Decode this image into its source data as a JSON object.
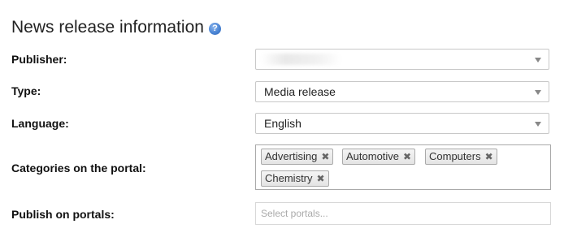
{
  "section": {
    "title": "News release information",
    "help_icon": "question-mark-icon"
  },
  "fields": {
    "publisher": {
      "label": "Publisher:",
      "value": ""
    },
    "type": {
      "label": "Type:",
      "value": "Media release"
    },
    "language": {
      "label": "Language:",
      "value": "English"
    },
    "categories": {
      "label": "Categories on the portal:",
      "tags": [
        "Advertising",
        "Automotive",
        "Computers",
        "Chemistry"
      ],
      "remove_glyph": "✖"
    },
    "portals": {
      "label": "Publish on portals:",
      "placeholder": "Select portals..."
    }
  },
  "colors": {
    "help_icon": "#4a84d4",
    "border": "#c8c8c8",
    "tag_border": "#aaaaaa",
    "placeholder": "#aaaaaa"
  }
}
